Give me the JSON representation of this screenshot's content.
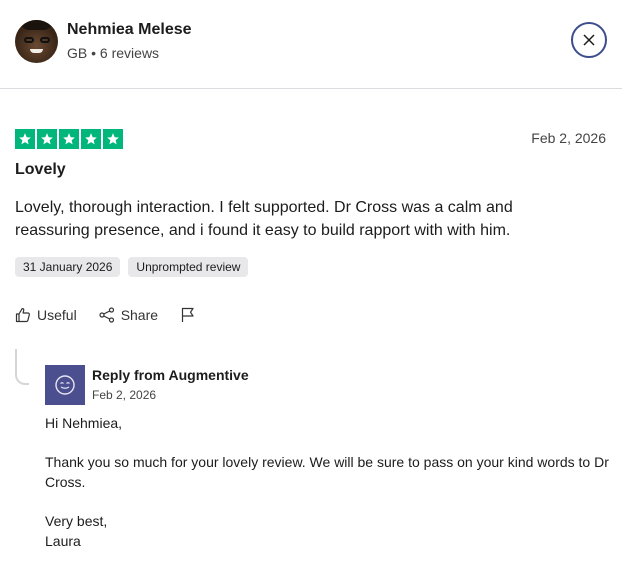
{
  "user": {
    "name": "Nehmiea Melese",
    "country": "GB",
    "separator": "•",
    "reviews": "6 reviews"
  },
  "review": {
    "rating": 5,
    "date": "Feb 2, 2026",
    "title": "Lovely",
    "body": "Lovely, thorough interaction. I felt supported. Dr Cross was a calm and reassuring presence, and i found it easy to build rapport with with him.",
    "tags": [
      "31 January 2026",
      "Unprompted review"
    ]
  },
  "actions": {
    "useful": "Useful",
    "share": "Share"
  },
  "reply": {
    "from": "Reply from Augmentive",
    "date": "Feb 2, 2026",
    "greeting": "Hi Nehmiea,",
    "message": "Thank you so much for your lovely review. We will be sure to pass on your kind words to Dr Cross.",
    "signoff": "Very best,",
    "signature": "Laura"
  },
  "colors": {
    "star_green": "#00b67a",
    "close_border": "#3d4d8f",
    "logo_bg": "#4b4e8f"
  },
  "icons": [
    "close-icon",
    "star-icon",
    "thumbs-up-icon",
    "share-icon",
    "flag-icon",
    "company-logo-icon"
  ]
}
